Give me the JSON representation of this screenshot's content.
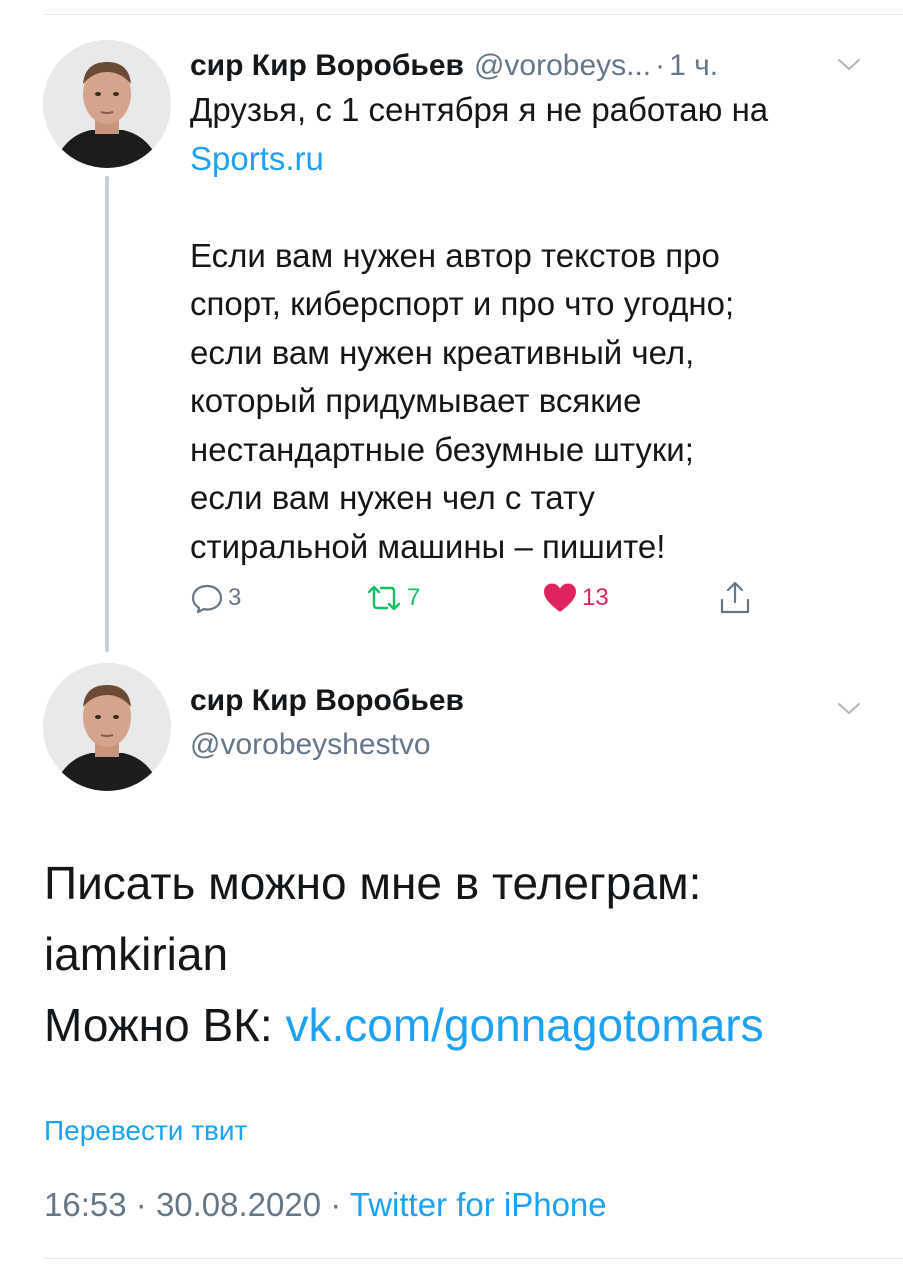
{
  "tweet1": {
    "display_name": "сир Кир Воробьев",
    "handle": "@vorobeys...",
    "separator": "·",
    "time": "1 ч.",
    "text_line1": "Друзья, с 1 сентября я не работаю на",
    "link": "Sports.ru",
    "paragraph2": [
      "Если вам нужен автор текстов про",
      "спорт, киберспорт и про что угодно;",
      "если вам нужен креативный чел,",
      "который придумывает всякие",
      "нестандартные безумные штуки;",
      "если вам нужен чел с тату",
      "стиральной машины – пишите!"
    ],
    "actions": {
      "replies": "3",
      "retweets": "7",
      "likes": "13"
    }
  },
  "tweet2": {
    "display_name": "сир Кир Воробьев",
    "handle": "@vorobeyshestvo",
    "lines": [
      "Писать можно мне в телеграм:",
      "iamkirian"
    ],
    "vk_prefix": "Можно ВК: ",
    "vk_link": "vk.com/gonnagotomars",
    "translate_label": "Перевести твит",
    "time": "16:53",
    "date": "30.08.2020",
    "separator": "·",
    "source": "Twitter for iPhone"
  },
  "colors": {
    "accent": "#1da1f2",
    "retweet": "#17bf63",
    "like": "#e0245e",
    "secondary_text": "#657786"
  },
  "icons": [
    "avatar",
    "chevron-down-icon",
    "reply-icon",
    "retweet-icon",
    "heart-icon",
    "share-icon"
  ]
}
